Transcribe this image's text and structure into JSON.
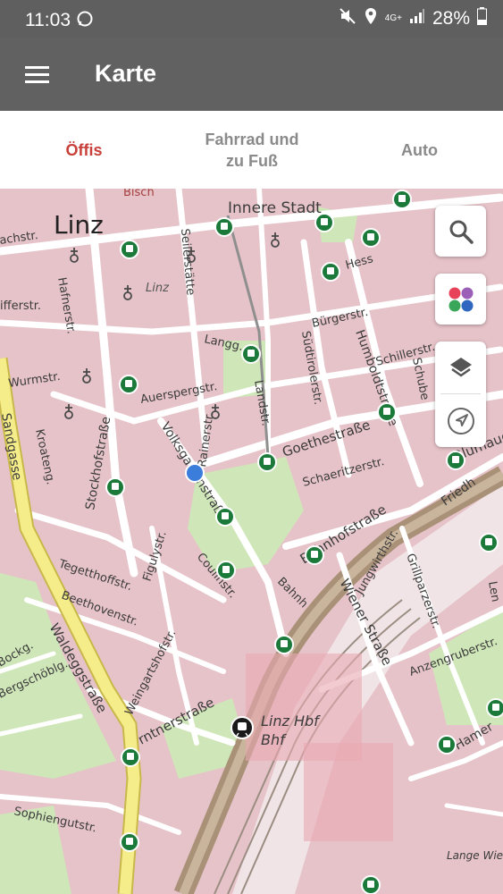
{
  "status_bar": {
    "time": "11:03",
    "battery_percent": "28%",
    "network": "4G+"
  },
  "app_bar": {
    "title": "Karte",
    "menu_icon": "hamburger-menu-icon"
  },
  "tabs": [
    {
      "label": "Öffis",
      "active": true
    },
    {
      "label": "Fahrrad und\nzu Fuß",
      "active": false
    },
    {
      "label": "Auto",
      "active": false
    }
  ],
  "colors": {
    "active_tab": "#c9403a",
    "app_bar": "#616161",
    "status_bar": "#5f5f5f",
    "location_dot": "#3a7ddb",
    "transit_stop": "#1b7a3a"
  },
  "map_controls": {
    "search": "search-icon",
    "color_palette": "palette-icon",
    "layers": "layers-icon",
    "locate": "navigation-arrow-icon"
  },
  "map_labels": {
    "city": "Linz",
    "innere_stadt": "Innere Stadt",
    "linz_small": "Linz",
    "bischof": "Bisch",
    "gachstr": "achstr.",
    "hafnerstr": "Hafnerstr.",
    "pfifferstr": "ifferstr.",
    "wurmstr": "Wurmstr.",
    "sandgasse": "Sandgasse",
    "kroatengasse": "Kroateng.",
    "stockhofstrasse": "Stockhofstraße",
    "seilerstaette": "Seilerstätte",
    "auerspergstr": "Auerspergstr.",
    "volksgartenstrasse": "Volksgartenstraße",
    "rainerstr": "Rainerstr.",
    "langg": "Langg.",
    "landstr": "Landstr.",
    "suedtirolerstr": "Südtirolerstr.",
    "buergerstr": "Bürgerstr.",
    "humboldtstrasse": "Humboldtstraße",
    "schillerstr": "Schillerstr.",
    "schube": "Schube",
    "hess": "Hess",
    "goethestrasse": "Goethestraße",
    "schaeritzerstr": "Schaeritzerstr.",
    "blumauerstr": "Blumauerst",
    "tegetthoffstr": "Tegetthoffstr.",
    "figulystr": "Figulystr.",
    "coulinstr": "Coulinstr.",
    "beethovenstr": "Beethovenstr.",
    "bahnhofstrasse": "Bahnhofstraße",
    "bahnhofstr2": "Bahnhofstr.",
    "jungwirthstr": "Jungwirthstr.",
    "grillparzerstr": "Grillparzerstr.",
    "wienerstrasse": "Wiener Straße",
    "friedh": "Friedh",
    "anzengruberstr": "Anzengruberstr.",
    "waldeggstrasse": "Waldeggstraße",
    "weingartshofstr": "Weingartshofstr.",
    "bockg": "Bockg.",
    "bergschoeblg": "Bergschöblg.",
    "kaerntnerstrasse": "rntnerstraße",
    "linz_hbf": "Linz Hbf",
    "bhf": "Bhf",
    "sophiengutstr": "Sophiengutstr.",
    "lange_wiesen": "Lange Wiesen",
    "hamer": "Hamer",
    "lenaug": "Len",
    "bahnhofstr_small": "Bahnh",
    "volksg_d": "Volksg"
  }
}
